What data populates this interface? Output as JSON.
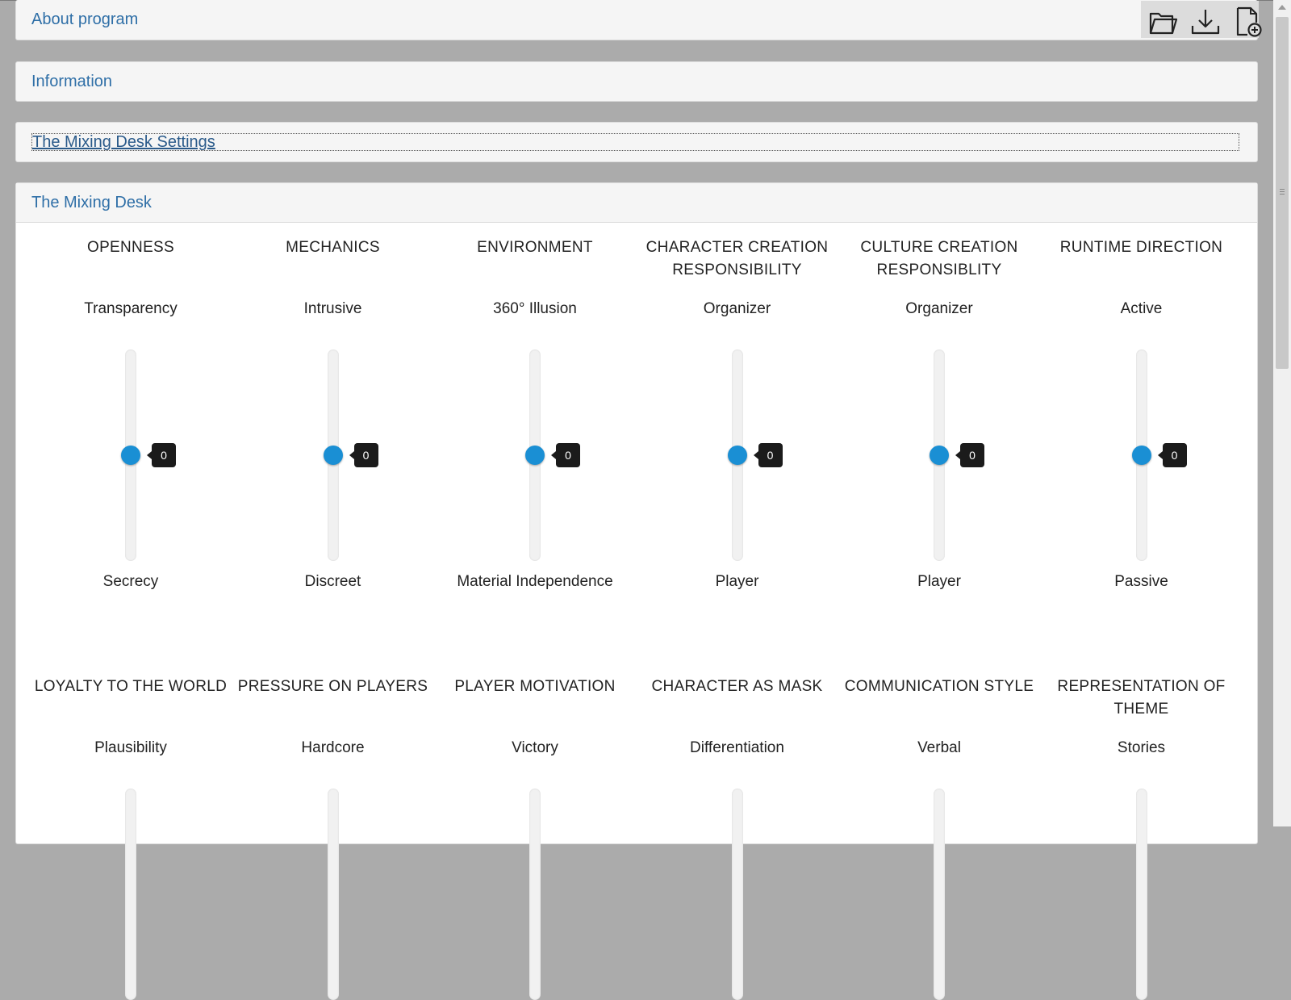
{
  "panels": {
    "about": "About program",
    "information": "Information",
    "settings": "The Mixing Desk Settings",
    "mixing_desk": "The Mixing Desk"
  },
  "toolbar": {
    "icons": [
      "folder-open-icon",
      "download-icon",
      "new-file-icon"
    ]
  },
  "sliders": [
    {
      "title": "OPENNESS",
      "top": "Transparency",
      "bottom": "Secrecy",
      "value": 0
    },
    {
      "title": "MECHANICS",
      "top": "Intrusive",
      "bottom": "Discreet",
      "value": 0
    },
    {
      "title": "ENVIRONMENT",
      "top": "360° Illusion",
      "bottom": "Material Independence",
      "value": 0
    },
    {
      "title": "CHARACTER CREATION RESPONSIBILITY",
      "top": "Organizer",
      "bottom": "Player",
      "value": 0
    },
    {
      "title": "CULTURE CREATION RESPONSIBLITY",
      "top": "Organizer",
      "bottom": "Player",
      "value": 0
    },
    {
      "title": "RUNTIME DIRECTION",
      "top": "Active",
      "bottom": "Passive",
      "value": 0
    },
    {
      "title": "LOYALTY TO THE WORLD",
      "top": "Plausibility",
      "bottom": "",
      "value": null
    },
    {
      "title": "PRESSURE ON PLAYERS",
      "top": "Hardcore",
      "bottom": "",
      "value": null
    },
    {
      "title": "PLAYER MOTIVATION",
      "top": "Victory",
      "bottom": "",
      "value": null
    },
    {
      "title": "CHARACTER AS MASK",
      "top": "Differentiation",
      "bottom": "",
      "value": null
    },
    {
      "title": "COMMUNICATION STYLE",
      "top": "Verbal",
      "bottom": "",
      "value": null
    },
    {
      "title": "REPRESENTATION OF THEME",
      "top": "Stories",
      "bottom": "",
      "value": null
    }
  ]
}
